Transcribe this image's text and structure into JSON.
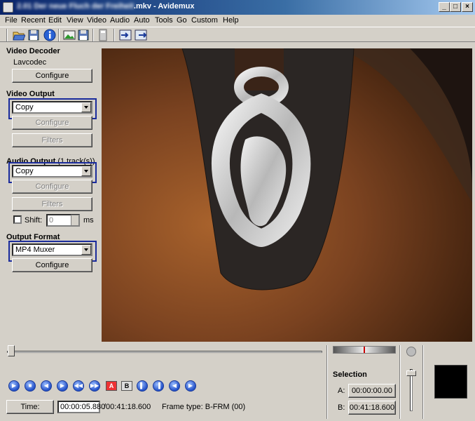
{
  "window": {
    "title_blurred": "2.01 Der neue Fluch der Freiheit",
    "title_rest": ".mkv - Avidemux",
    "controls": [
      "_",
      "□",
      "×"
    ]
  },
  "menu": [
    "File",
    "Recent",
    "Edit",
    "View",
    "Video",
    "Audio",
    "Auto",
    "Tools",
    "Go",
    "Custom",
    "Help"
  ],
  "left": {
    "video_decoder_header": "Video Decoder",
    "video_decoder_name": "Lavcodec",
    "decoder_configure": "Configure",
    "video_output_header": "Video Output",
    "video_output_value": "Copy",
    "video_configure": "Configure",
    "video_filters": "Filters",
    "audio_output_header": "Audio Output",
    "audio_output_tracks": "(1 track(s))",
    "audio_output_value": "Copy",
    "audio_configure": "Configure",
    "audio_filters": "Filters",
    "shift_label": "Shift:",
    "shift_value": "0",
    "shift_unit": "ms",
    "output_format_header": "Output Format",
    "output_format_value": "MP4 Muxer",
    "format_configure": "Configure"
  },
  "bottom": {
    "playback_position": 0.0023,
    "selection_header": "Selection",
    "a_label": "A:",
    "a_value": "00:00:00.00",
    "b_label": "B:",
    "b_value": "00:41:18.600",
    "time_button": "Time:",
    "current_time": "00:00:05.880",
    "total_time": "/00:41:18.600",
    "frame_type": "Frame type:  B-FRM (00)",
    "marker_a": "A",
    "marker_b": "B"
  },
  "colors": {
    "titlebar": "#0a246a",
    "highlight_box": "#1a2b9c",
    "chrome": "#d4d0c8"
  }
}
